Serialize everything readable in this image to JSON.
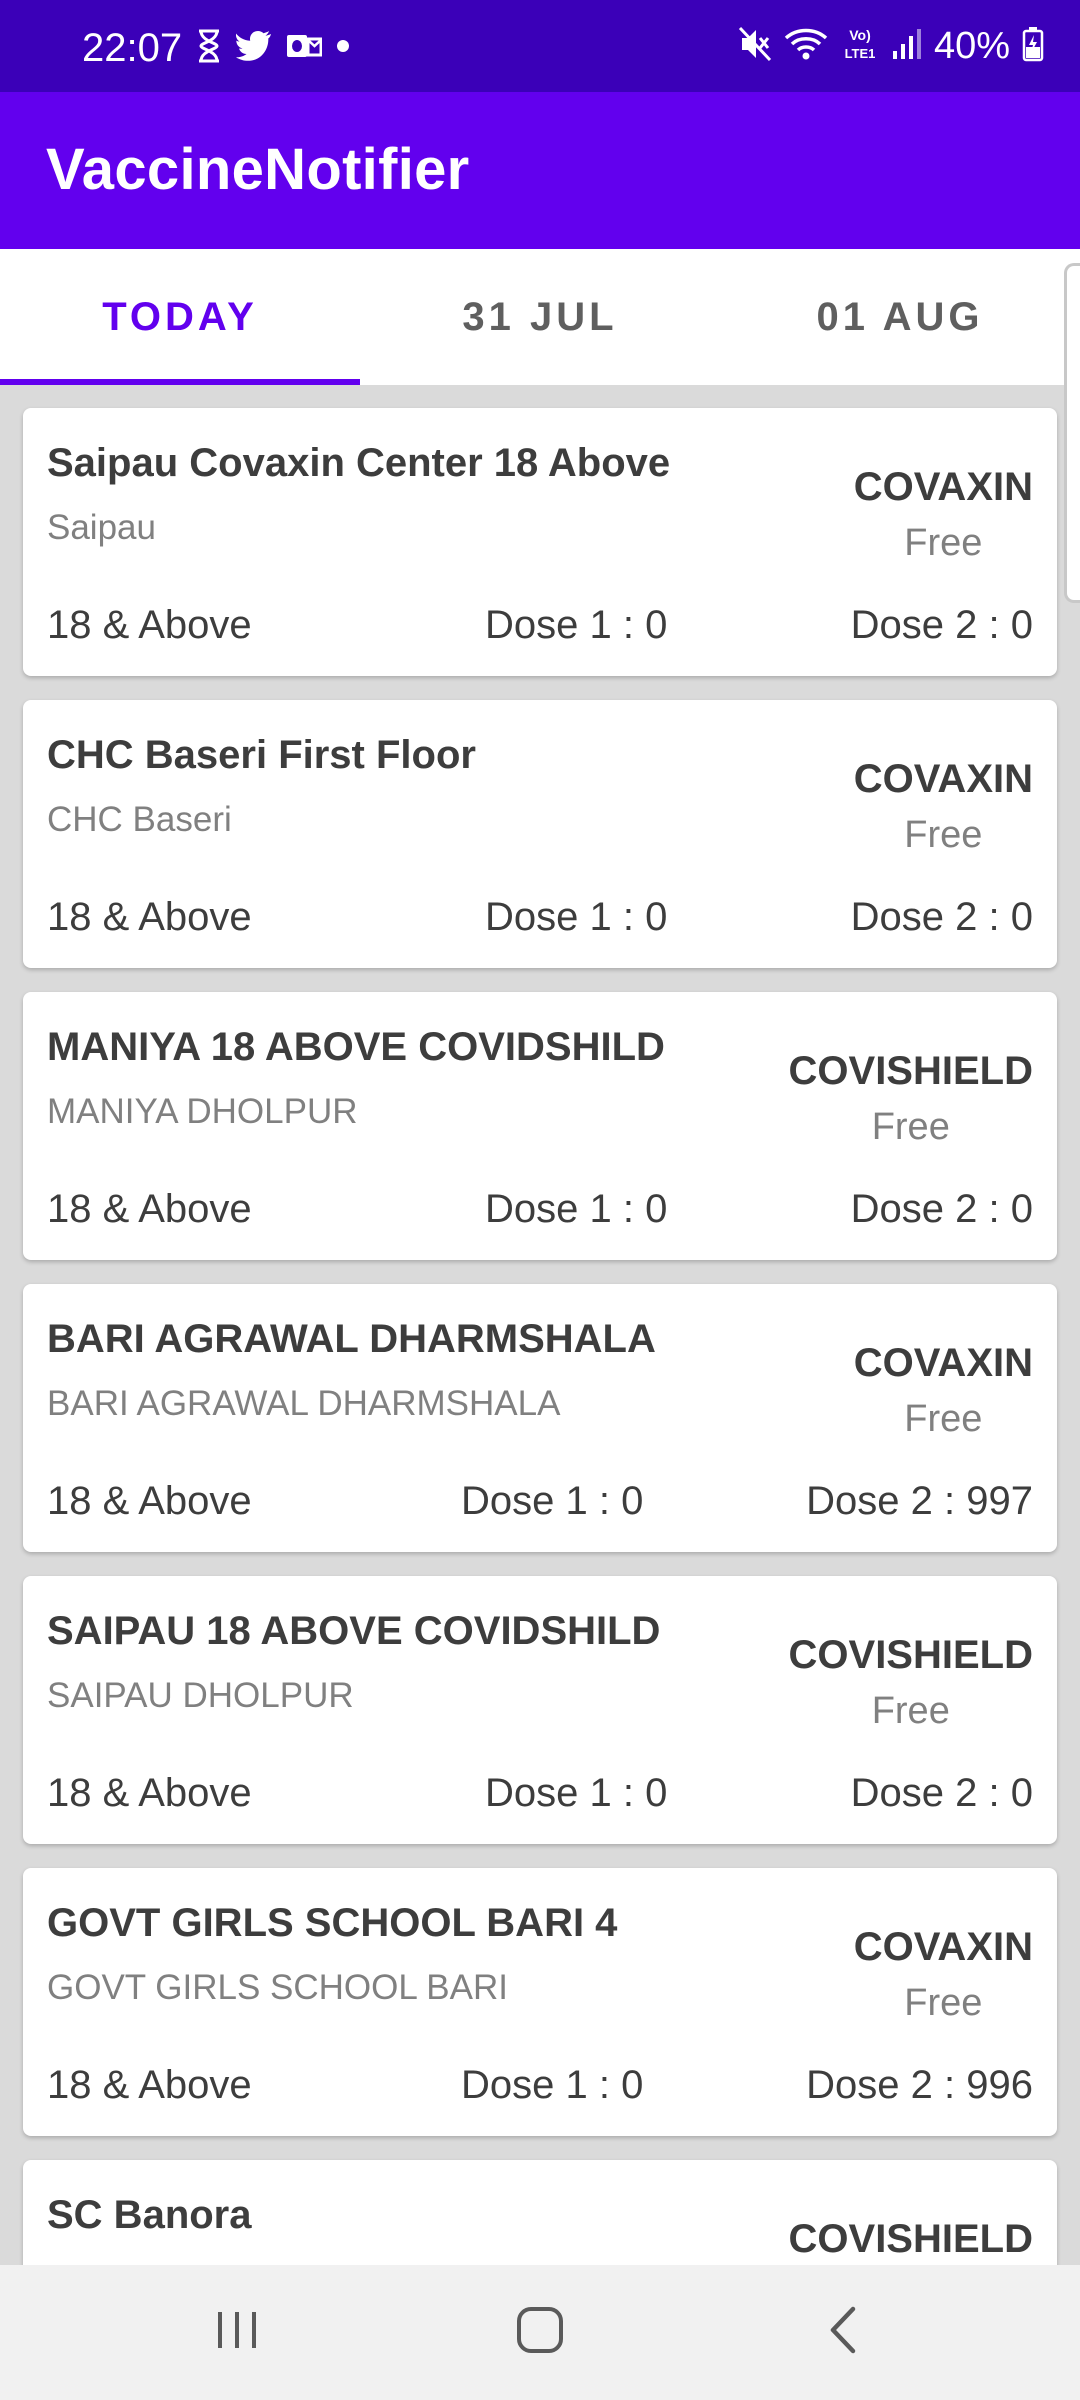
{
  "status_bar": {
    "time": "22:07",
    "battery": "40%",
    "left_icons": [
      "hourglass-icon",
      "twitter-icon",
      "outlook-icon",
      "dot-icon"
    ],
    "right_icons": [
      "mute-icon",
      "wifi-icon",
      "volte-icon",
      "signal-icon",
      "battery-icon"
    ]
  },
  "app_bar": {
    "title": "VaccineNotifier"
  },
  "tabs": [
    {
      "label": "TODAY",
      "active": true
    },
    {
      "label": "31 JUL",
      "active": false
    },
    {
      "label": "01 AUG",
      "active": false
    }
  ],
  "colors": {
    "status_bar": "#3b00b8",
    "primary": "#6200ee",
    "text_dark": "#3d3d3d",
    "text_muted": "#808080",
    "list_background": "#dadada"
  },
  "centers": [
    {
      "name": "Saipau Covaxin Center 18 Above",
      "address": "Saipau",
      "vaccine": "COVAXIN",
      "fee": "Free",
      "age": "18 & Above",
      "dose1": "Dose 1 : 0",
      "dose2": "Dose 2 : 0"
    },
    {
      "name": "CHC Baseri First Floor",
      "address": "CHC Baseri",
      "vaccine": "COVAXIN",
      "fee": "Free",
      "age": "18 & Above",
      "dose1": "Dose 1 : 0",
      "dose2": "Dose 2 : 0"
    },
    {
      "name": "MANIYA 18 ABOVE COVIDSHILD",
      "address": "MANIYA DHOLPUR",
      "vaccine": "COVISHIELD",
      "fee": "Free",
      "age": "18 & Above",
      "dose1": "Dose 1 : 0",
      "dose2": "Dose 2 : 0"
    },
    {
      "name": "BARI AGRAWAL DHARMSHALA",
      "address": "BARI AGRAWAL DHARMSHALA",
      "vaccine": "COVAXIN",
      "fee": "Free",
      "age": "18 & Above",
      "dose1": "Dose 1 : 0",
      "dose2": "Dose 2 : 997"
    },
    {
      "name": "SAIPAU 18 ABOVE COVIDSHILD",
      "address": "SAIPAU DHOLPUR",
      "vaccine": "COVISHIELD",
      "fee": "Free",
      "age": "18 & Above",
      "dose1": "Dose 1 : 0",
      "dose2": "Dose 2 : 0"
    },
    {
      "name": "GOVT GIRLS SCHOOL BARI 4",
      "address": "GOVT GIRLS SCHOOL BARI",
      "vaccine": "COVAXIN",
      "fee": "Free",
      "age": "18 & Above",
      "dose1": "Dose 1 : 0",
      "dose2": "Dose 2 : 996"
    },
    {
      "name": "SC Banora",
      "address": "",
      "vaccine": "COVISHIELD",
      "fee": "",
      "age": "",
      "dose1": "",
      "dose2": ""
    }
  ],
  "nav_bar": {
    "buttons": [
      "recents-icon",
      "home-icon",
      "back-icon"
    ]
  }
}
